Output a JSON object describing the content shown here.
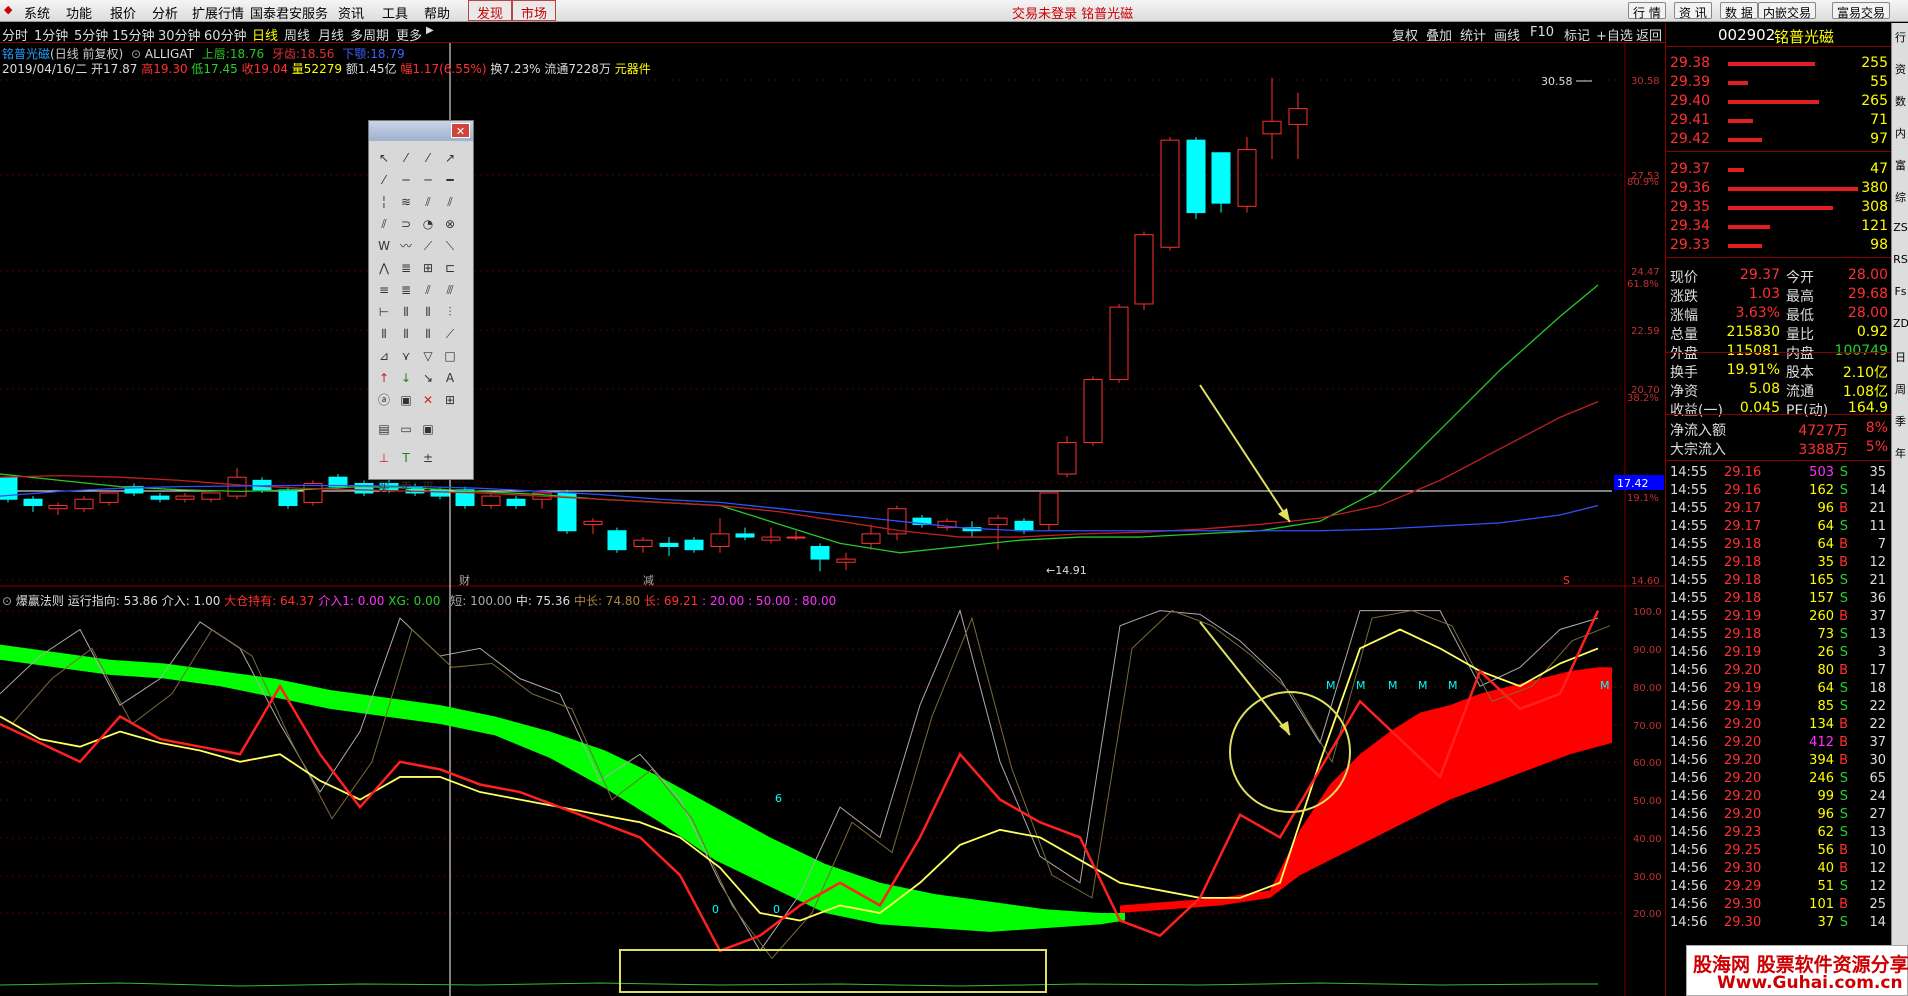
{
  "menubar": {
    "items": [
      "系统",
      "功能",
      "报价",
      "分析",
      "扩展行情",
      "国泰君安服务",
      "资讯",
      "工具",
      "帮助"
    ],
    "highlight": [
      "发现",
      "市场"
    ],
    "center_text": "交易未登录  铭普光磁",
    "right_buttons": [
      "行 情",
      "资 讯",
      "数 据",
      "内嵌交易",
      "富易交易"
    ]
  },
  "periods": [
    "分时",
    "1分钟",
    "5分钟",
    "15分钟",
    "30分钟",
    "60分钟",
    "日线",
    "周线",
    "月线",
    "多周期",
    "更多"
  ],
  "period_active": "日线",
  "toolbar_right": [
    "复权",
    "叠加",
    "统计",
    "画线",
    "F10",
    "标记",
    "+自选",
    "返回"
  ],
  "chart_header": {
    "stock": "铭普光磁",
    "mode": "(日线 前复权)",
    "indicator": "ALLIGAT",
    "upper": "上唇:18.76",
    "teeth": "牙齿:18.56",
    "lower": "下颚:18.79",
    "bar_date": "2019/04/16/二",
    "open": "开17.87",
    "high": "高19.30",
    "low": "低17.45",
    "close": "收19.04",
    "volume": "量52279",
    "amount": "额1.45亿",
    "change": "幅1.17(6.55%)",
    "turnover": "换7.23%",
    "float": "流通7228万",
    "sector": "元器件"
  },
  "price_axis": [
    "30.58",
    "27.53",
    "24.47",
    "22.59",
    "20.70",
    "17.42",
    "14.60"
  ],
  "pct_axis": [
    "80.9%",
    "61.8%",
    "38.2%",
    "19.1%"
  ],
  "cursor_price": "17.42",
  "kline_labels": {
    "max": "30.58",
    "min": "←14.91",
    "fin": "财",
    "cut": "减",
    "s": "S"
  },
  "indicator_header": {
    "name": "爆赢法则",
    "running": "运行指向: 53.86",
    "enter": "介入: 1.00",
    "big_hold": "大仓持有: 64.37",
    "enter1": "介入1: 0.00",
    "xg": "XG: 0.00",
    "short": "短: 100.00",
    "mid": "中: 75.36",
    "midlong": "中长: 74.80",
    "long": "长: 69.21",
    "levels": ": 20.00  : 50.00  : 80.00"
  },
  "ind_axis": [
    "100.0",
    "90.00",
    "80.00",
    "70.00",
    "60.00",
    "50.00",
    "40.00",
    "30.00",
    "20.00"
  ],
  "ind_marks": {
    "m": "M",
    "six": "6",
    "zero": "0"
  },
  "quote": {
    "code": "002902",
    "name": "铭普光磁",
    "asks": [
      {
        "price": "29.42",
        "vol": "97",
        "bar": 0.26
      },
      {
        "price": "29.41",
        "vol": "71",
        "bar": 0.19
      },
      {
        "price": "29.40",
        "vol": "265",
        "bar": 0.7
      },
      {
        "price": "29.39",
        "vol": "55",
        "bar": 0.15
      },
      {
        "price": "29.38",
        "vol": "255",
        "bar": 0.67
      }
    ],
    "bids": [
      {
        "price": "29.37",
        "vol": "47",
        "bar": 0.12
      },
      {
        "price": "29.36",
        "vol": "380",
        "bar": 1.0
      },
      {
        "price": "29.35",
        "vol": "308",
        "bar": 0.81
      },
      {
        "price": "29.34",
        "vol": "121",
        "bar": 0.32
      },
      {
        "price": "29.33",
        "vol": "98",
        "bar": 0.26
      }
    ],
    "stats": [
      {
        "l1": "现价",
        "v1": "29.37",
        "l2": "今开",
        "v2": "28.00"
      },
      {
        "l1": "涨跌",
        "v1": "1.03",
        "l2": "最高",
        "v2": "29.68"
      },
      {
        "l1": "涨幅",
        "v1": "3.63%",
        "l2": "最低",
        "v2": "28.00"
      },
      {
        "l1": "总量",
        "v1": "215830",
        "l2": "量比",
        "v2": "0.92"
      },
      {
        "l1": "外盘",
        "v1": "115081",
        "l2": "内盘",
        "v2": "100749"
      }
    ],
    "stats2": [
      {
        "l1": "换手",
        "v1": "19.91%",
        "l2": "股本",
        "v2": "2.10亿"
      },
      {
        "l1": "净资",
        "v1": "5.08",
        "l2": "流通",
        "v2": "1.08亿"
      },
      {
        "l1": "收益(一)",
        "v1": "0.045",
        "l2": "PE(动)",
        "v2": "164.9"
      }
    ],
    "flow": [
      {
        "label": "净流入额",
        "val": "4727万",
        "pct": "8%"
      },
      {
        "label": "大宗流入",
        "val": "3388万",
        "pct": "5%"
      }
    ],
    "ticks": [
      [
        "14:55",
        "29.16",
        "503",
        "S",
        "35"
      ],
      [
        "14:55",
        "29.16",
        "162",
        "S",
        "14"
      ],
      [
        "14:55",
        "29.17",
        "96",
        "B",
        "21"
      ],
      [
        "14:55",
        "29.17",
        "64",
        "S",
        "11"
      ],
      [
        "14:55",
        "29.18",
        "64",
        "B",
        "7"
      ],
      [
        "14:55",
        "29.18",
        "35",
        "B",
        "12"
      ],
      [
        "14:55",
        "29.18",
        "165",
        "S",
        "21"
      ],
      [
        "14:55",
        "29.18",
        "157",
        "S",
        "36"
      ],
      [
        "14:55",
        "29.19",
        "260",
        "B",
        "37"
      ],
      [
        "14:55",
        "29.18",
        "73",
        "S",
        "13"
      ],
      [
        "14:56",
        "29.19",
        "26",
        "S",
        "3"
      ],
      [
        "14:56",
        "29.20",
        "80",
        "B",
        "17"
      ],
      [
        "14:56",
        "29.19",
        "64",
        "S",
        "18"
      ],
      [
        "14:56",
        "29.19",
        "85",
        "S",
        "22"
      ],
      [
        "14:56",
        "29.20",
        "134",
        "B",
        "22"
      ],
      [
        "14:56",
        "29.20",
        "412",
        "B",
        "37"
      ],
      [
        "14:56",
        "29.20",
        "394",
        "B",
        "30"
      ],
      [
        "14:56",
        "29.20",
        "246",
        "S",
        "65"
      ],
      [
        "14:56",
        "29.20",
        "99",
        "S",
        "24"
      ],
      [
        "14:56",
        "29.20",
        "96",
        "S",
        "27"
      ],
      [
        "14:56",
        "29.23",
        "62",
        "S",
        "13"
      ],
      [
        "14:56",
        "29.25",
        "56",
        "B",
        "10"
      ],
      [
        "14:56",
        "29.30",
        "40",
        "B",
        "12"
      ],
      [
        "14:56",
        "29.29",
        "51",
        "S",
        "12"
      ],
      [
        "14:56",
        "29.30",
        "101",
        "B",
        "25"
      ],
      [
        "14:56",
        "29.30",
        "37",
        "S",
        "14"
      ]
    ]
  },
  "vtabs": [
    "行",
    "资",
    "数",
    "内",
    "富",
    "综",
    "ZS",
    "RS",
    "Fs",
    "ZD",
    "日",
    "周",
    "季",
    "年"
  ],
  "logo": {
    "title": "股海网 股票软件资源分享",
    "url": "Www.Guhai.com.cn"
  },
  "colors": {
    "up": "#ff3030",
    "down": "#00ffff",
    "axis": "#800000"
  }
}
